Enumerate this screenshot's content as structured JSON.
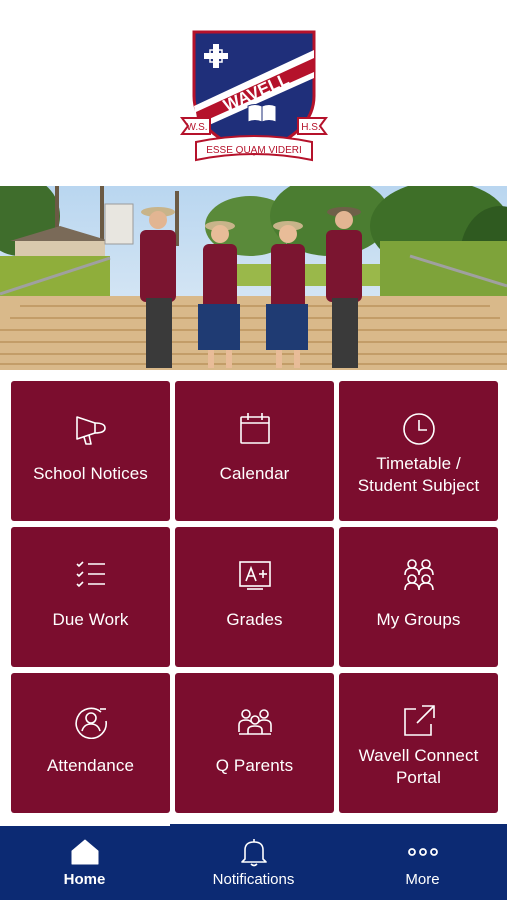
{
  "logo": {
    "name": "WAVELL",
    "initials_left": "W.S.",
    "initials_right": "H.S.",
    "motto": "ESSE QUAM VIDERI"
  },
  "hero": {
    "icon": "students-photo"
  },
  "tiles": [
    {
      "label": "School Notices",
      "icon": "megaphone-icon"
    },
    {
      "label": "Calendar",
      "icon": "calendar-icon"
    },
    {
      "label": "Timetable /\nStudent Subject",
      "icon": "clock-icon"
    },
    {
      "label": "Due Work",
      "icon": "checklist-icon"
    },
    {
      "label": "Grades",
      "icon": "grade-icon"
    },
    {
      "label": "My Groups",
      "icon": "groups-icon"
    },
    {
      "label": "Attendance",
      "icon": "attendance-icon"
    },
    {
      "label": "Q Parents",
      "icon": "parents-icon"
    },
    {
      "label": "Wavell Connect\nPortal",
      "icon": "external-link-icon"
    }
  ],
  "nav": [
    {
      "label": "Home",
      "icon": "home-icon",
      "active": true
    },
    {
      "label": "Notifications",
      "icon": "bell-icon",
      "active": false
    },
    {
      "label": "More",
      "icon": "more-icon",
      "active": false
    }
  ],
  "colors": {
    "tile": "#7b0d2e",
    "nav": "#0c2a73",
    "crest_blue": "#1f2f7a",
    "crest_red": "#b5122b"
  }
}
